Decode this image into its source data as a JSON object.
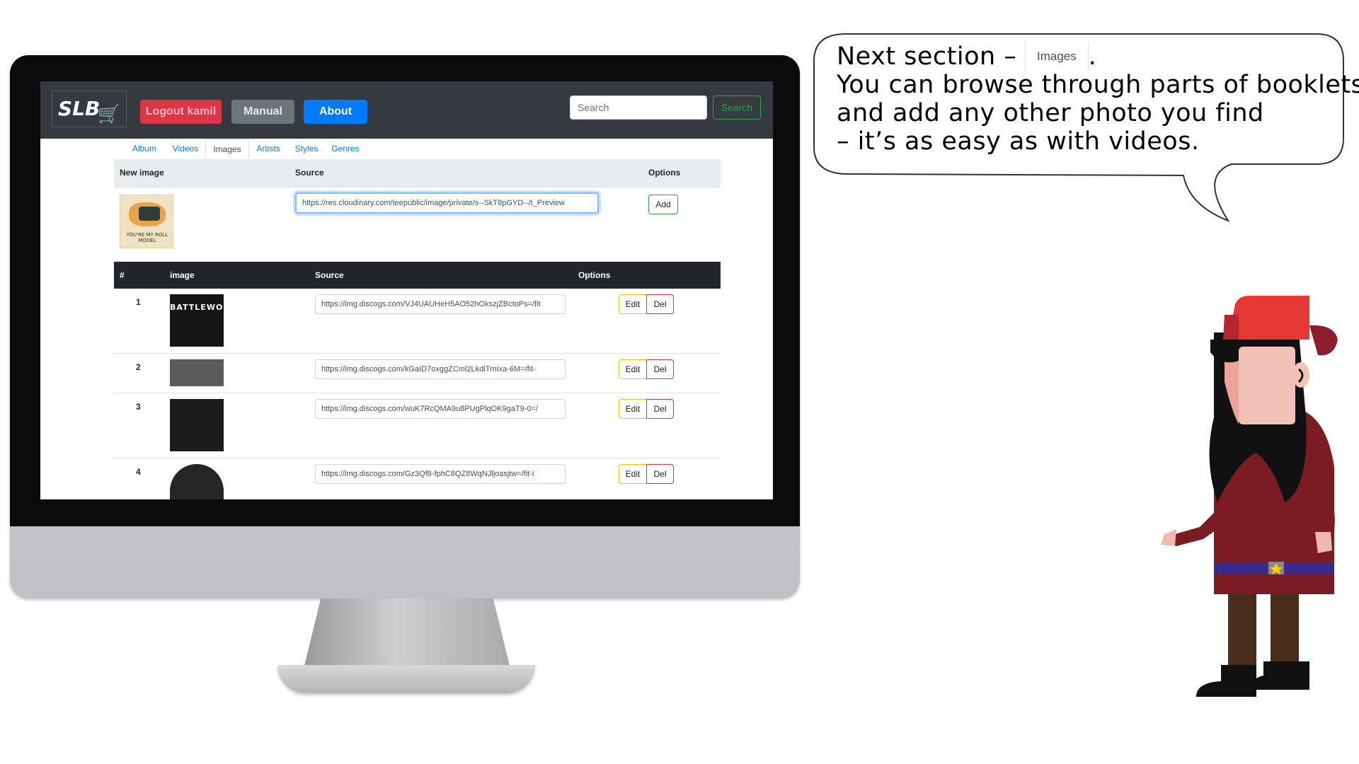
{
  "navbar": {
    "logo_text": "SLB",
    "logout_label": "Logout kamil",
    "manual_label": "Manual",
    "about_label": "About",
    "search_placeholder": "Search",
    "search_button": "Search"
  },
  "tabs": [
    "Album",
    "Videos",
    "Images",
    "Artists",
    "Styles",
    "Genres"
  ],
  "active_tab": "Images",
  "new_image": {
    "col_new_image": "New image",
    "col_source": "Source",
    "col_options": "Options",
    "thumb_caption": "YOU'RE MY ROLL MODEL",
    "source_value": "https://res.cloudinary.com/teepublic/image/private/s--SkT8pGYD--/t_Preview",
    "add_label": "Add"
  },
  "images_table": {
    "headers": {
      "num": "#",
      "image": "image",
      "source": "Source",
      "options": "Options"
    },
    "rows": [
      {
        "num": "1",
        "thumb_label": "BATTLEWORD",
        "source": "https://img.discogs.com/VJ4UAUHeH5AO52hOkszjZBctoPs=/fit",
        "edit": "Edit",
        "del": "Del"
      },
      {
        "num": "2",
        "thumb_label": "",
        "source": "https://img.discogs.com/kGaID7oxggZCml2LkdlTmIxa-6M=/fit-",
        "edit": "Edit",
        "del": "Del"
      },
      {
        "num": "3",
        "thumb_label": "",
        "source": "https://img.discogs.com/wuK7RcQMA9u8PUgPlqOK9gaT9-0=/",
        "edit": "Edit",
        "del": "Del"
      },
      {
        "num": "4",
        "thumb_label": "",
        "source": "https://img.discogs.com/Gz3Qf8-fphC8QZ8WqNJljoasjtw=/fit-i",
        "edit": "Edit",
        "del": "Del"
      }
    ]
  },
  "bubble": {
    "line1_prefix": "Next section –",
    "line1_tab": "Images",
    "line1_suffix": ".",
    "line2": "You can browse through parts of booklets,",
    "line3": "and add any other photo you find",
    "line4": "– it’s as easy as with videos."
  },
  "colors": {
    "navbar_bg": "#343a40",
    "logout": "#dc3545",
    "manual": "#6c757d",
    "about": "#007bff",
    "search_btn": "#28a745",
    "table_head": "#212529",
    "character_cap": "#e53935",
    "character_shirt": "#7a1c22"
  }
}
